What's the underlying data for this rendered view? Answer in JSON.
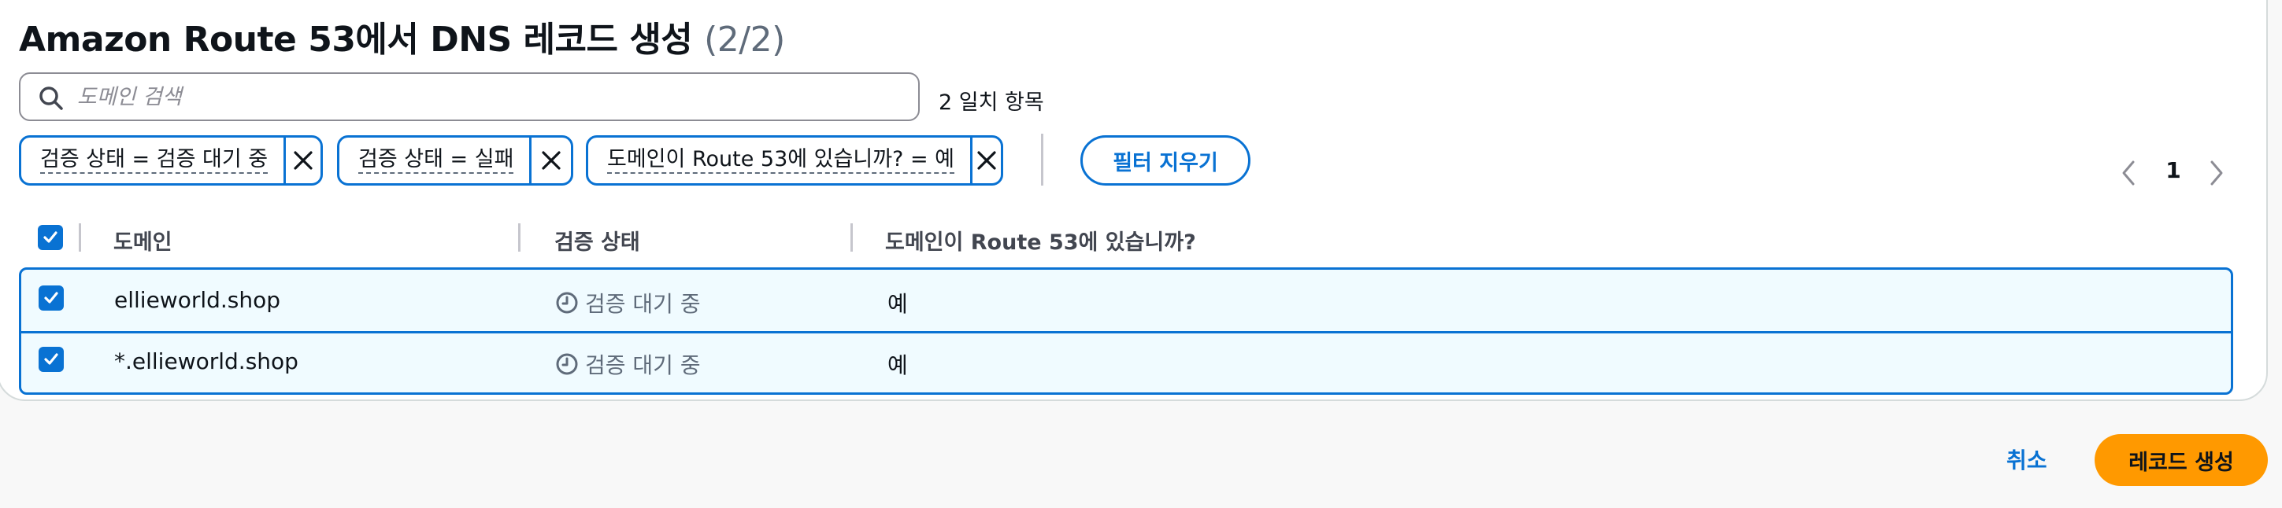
{
  "header": {
    "title": "Amazon Route 53에서 DNS 레코드 생성",
    "count": "(2/2)"
  },
  "search": {
    "placeholder": "도메인 검색",
    "value": "",
    "match_count": "2 일치 항목"
  },
  "filters": {
    "tokens": [
      {
        "label": "검증 상태 = 검증 대기 중"
      },
      {
        "label": "검증 상태 = 실패"
      },
      {
        "label": "도메인이 Route 53에 있습니까? = 예"
      }
    ],
    "clear_label": "필터 지우기"
  },
  "pagination": {
    "current_page": "1"
  },
  "table": {
    "columns": [
      "도메인",
      "검증 상태",
      "도메인이 Route 53에 있습니까?"
    ],
    "select_all_checked": true,
    "rows": [
      {
        "checked": true,
        "domain": "ellieworld.shop",
        "status": "검증 대기 중",
        "in_route53": "예"
      },
      {
        "checked": true,
        "domain": "*.ellieworld.shop",
        "status": "검증 대기 중",
        "in_route53": "예"
      }
    ]
  },
  "footer": {
    "cancel_label": "취소",
    "submit_label": "레코드 생성"
  },
  "colors": {
    "accent": "#0972d3",
    "primary_button": "#ff9900",
    "selected_row_bg": "#f0fbff",
    "muted_text": "#5f6b7a"
  },
  "icons": {
    "search": "search-icon",
    "token_close": "close-icon",
    "checkbox": "checkmark-icon",
    "status": "clock-icon",
    "prev_page": "chevron-left-icon",
    "next_page": "chevron-right-icon"
  }
}
